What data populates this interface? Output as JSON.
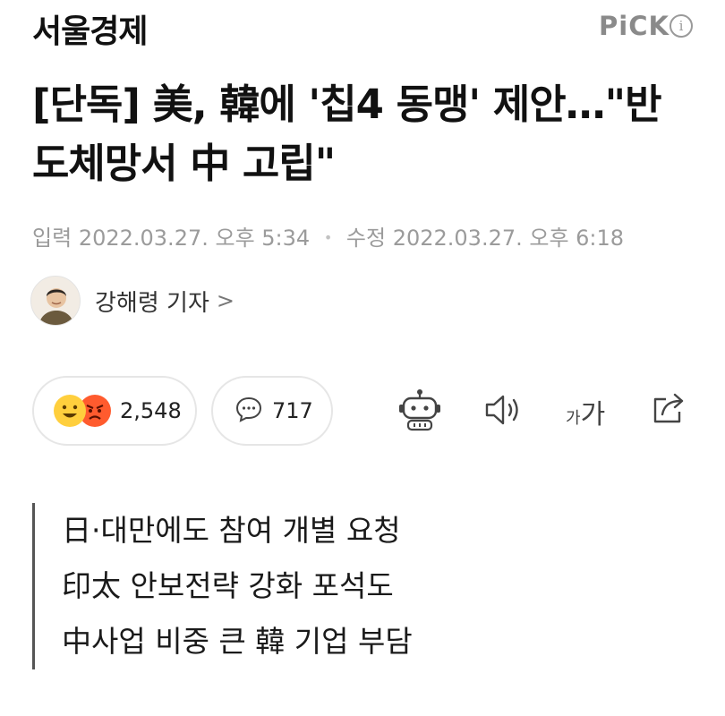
{
  "header": {
    "brand": "서울경제",
    "pick_label": "PiCK",
    "info_glyph": "i"
  },
  "article": {
    "title": "[단독] 美, 韓에 '칩4 동맹' 제안…\"반도체망서 中 고립\"",
    "input_label": "입력",
    "input_datetime": "2022.03.27. 오후 5:34",
    "separator": "•",
    "edit_label": "수정",
    "edit_datetime": "2022.03.27. 오후 6:18",
    "author": "강해령 기자",
    "author_chevron": ">",
    "summary": [
      "日·대만에도 참여 개별 요청",
      "印太 안보전략 강화 포석도",
      "中사업 비중 큰 韓 기업 부담"
    ]
  },
  "actions": {
    "reaction_count": "2,548",
    "comment_count": "717",
    "font_size_small": "가",
    "font_size_large": "가",
    "icons": [
      "smile-emoji-icon",
      "angry-emoji-icon",
      "comment-icon",
      "robot-summary-icon",
      "speaker-icon",
      "font-size-icon",
      "share-icon"
    ]
  },
  "colors": {
    "pick_gray": "#8a8a8a",
    "meta_gray": "#9b9b9b",
    "border_gray": "#e6e6e6",
    "emoji_yellow": "#ffcf3d",
    "emoji_red": "#ff5b2e",
    "quote_bar": "#555555"
  }
}
